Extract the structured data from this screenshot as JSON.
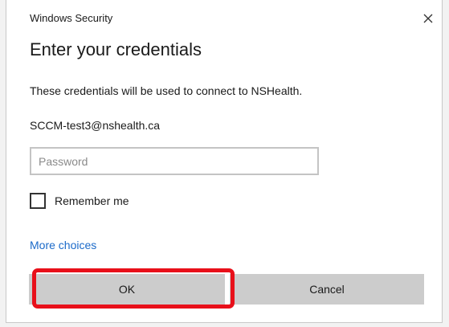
{
  "window": {
    "title": "Windows Security",
    "close_icon": "close-icon"
  },
  "dialog": {
    "heading": "Enter your credentials",
    "description": "These credentials will be used to connect to NSHealth.",
    "username": "SCCM-test3@nshealth.ca",
    "password": {
      "value": "",
      "placeholder": "Password"
    },
    "remember_me": {
      "label": "Remember me",
      "checked": false
    },
    "more_choices_label": "More choices",
    "ok_label": "OK",
    "cancel_label": "Cancel"
  },
  "colors": {
    "link": "#1b6ac9",
    "button_bg": "#cccccc",
    "highlight": "#e8101a"
  }
}
